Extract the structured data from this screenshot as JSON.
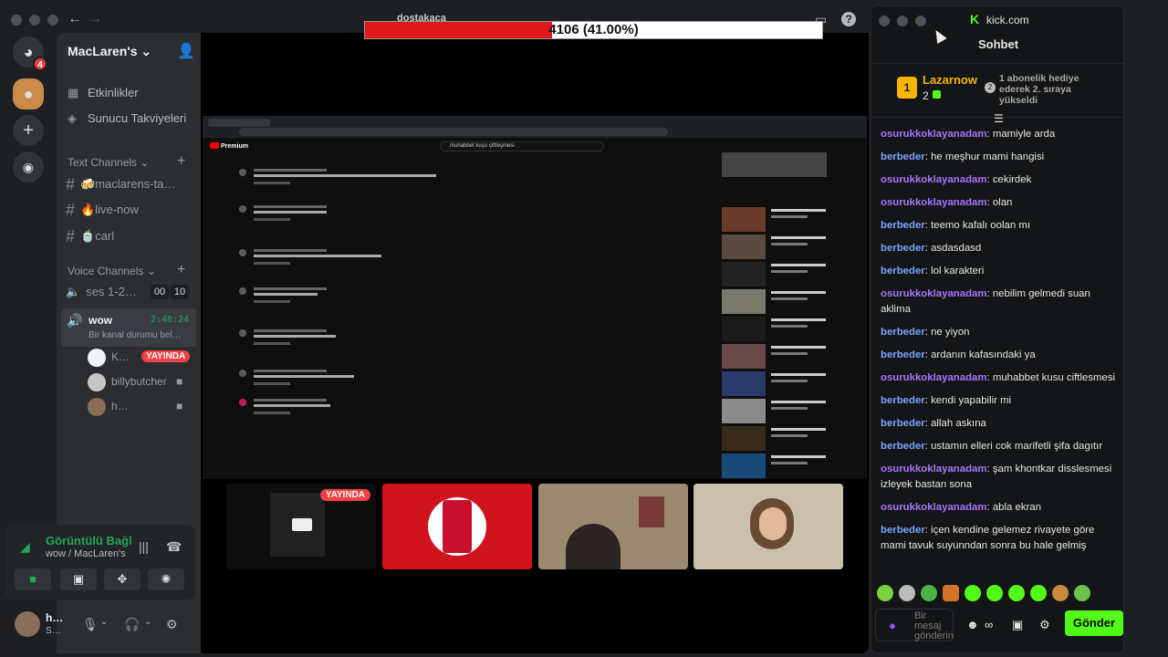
{
  "progress": {
    "text": "4106 (41.00%)",
    "fraction": 0.41,
    "ghost_text": "dostakaca"
  },
  "discord": {
    "title_tab": "MacLaren's",
    "mention_badge": "4",
    "server_name": "MacLaren's",
    "top_items": [
      {
        "label": "Etkinlikler",
        "icon": "calendar-icon"
      },
      {
        "label": "Sunucu Takviyeleri",
        "icon": "boost-icon"
      }
    ],
    "text_category": "Text Channels",
    "text_channels": [
      "🍻maclarens-ta…",
      "🔥live-now",
      "🍵carl"
    ],
    "voice_category": "Voice Channels",
    "voice_channels": [
      {
        "name": "ses 1-2…",
        "count": "00",
        "limit": "10"
      },
      {
        "name": "wow",
        "timer": "2:48:24",
        "status": "Bir kanal durumu bel…"
      }
    ],
    "voice_users": [
      {
        "name": "K…",
        "live": "YAYINDA"
      },
      {
        "name": "billybutcher"
      },
      {
        "name": "h…"
      }
    ],
    "voice_panel": {
      "status": "Görüntülü Bağl",
      "sub": "wow / MacLaren's"
    },
    "user": {
      "name": "h…",
      "status": "S…"
    }
  },
  "stage": {
    "tile_live": "YAYINDA",
    "yt_search": "muhabbet kuşu çiftleşmesi",
    "yt_premium": "Premium"
  },
  "kick": {
    "site": "kick.com",
    "header": "Sohbet",
    "pinned": {
      "name": "Lazarnow",
      "rank_num": "1",
      "gifts": "2",
      "message": "1 abonelik hediye ederek 2. sıraya yükseldi",
      "next_rank": "2"
    },
    "messages": [
      {
        "user": "osurukkoklayanadam",
        "text": "mamiyle arda",
        "color": "purple"
      },
      {
        "user": "berbeder",
        "text": "he meşhur mami hangisi",
        "color": "blue"
      },
      {
        "user": "osurukkoklayanadam",
        "text": "cekirdek",
        "color": "purple"
      },
      {
        "user": "osurukkoklayanadam",
        "text": "olan",
        "color": "purple"
      },
      {
        "user": "berbeder",
        "text": "teemo kafalı oolan mı",
        "color": "blue"
      },
      {
        "user": "berbeder",
        "text": "asdasdasd",
        "color": "blue"
      },
      {
        "user": "berbeder",
        "text": "lol karakteri",
        "color": "blue"
      },
      {
        "user": "osurukkoklayanadam",
        "text": "nebilim gelmedi suan aklima",
        "color": "purple"
      },
      {
        "user": "berbeder",
        "text": "ne yiyon",
        "color": "blue"
      },
      {
        "user": "berbeder",
        "text": "ardanın kafasındaki ya",
        "color": "blue"
      },
      {
        "user": "osurukkoklayanadam",
        "text": "muhabbet kusu ciftlesmesi",
        "color": "purple"
      },
      {
        "user": "berbeder",
        "text": "kendi yapabilir mi",
        "color": "blue"
      },
      {
        "user": "berbeder",
        "text": "allah askına",
        "color": "blue"
      },
      {
        "user": "berbeder",
        "text": "ustamın elleri cok marifetli şifa dagıtır",
        "color": "blue"
      },
      {
        "user": "osurukkoklayanadam",
        "text": "şam khontkar disslesmesi izleyek bastan sona",
        "color": "purple"
      },
      {
        "user": "osurukkoklayanadam",
        "text": "abla ekran",
        "color": "purple"
      },
      {
        "user": "berbeder",
        "text": "içen kendine gelemez rivayete göre mami tavuk suyunndan sonra bu hale gelmiş",
        "color": "blue"
      }
    ],
    "input_placeholder": "Bir mesaj gönderin",
    "send_label": "Gönder"
  },
  "colors": {
    "accent_green": "#53fc18",
    "discord_green": "#23a55a",
    "live_red": "#f23f43",
    "progress_red": "#e0171c"
  }
}
